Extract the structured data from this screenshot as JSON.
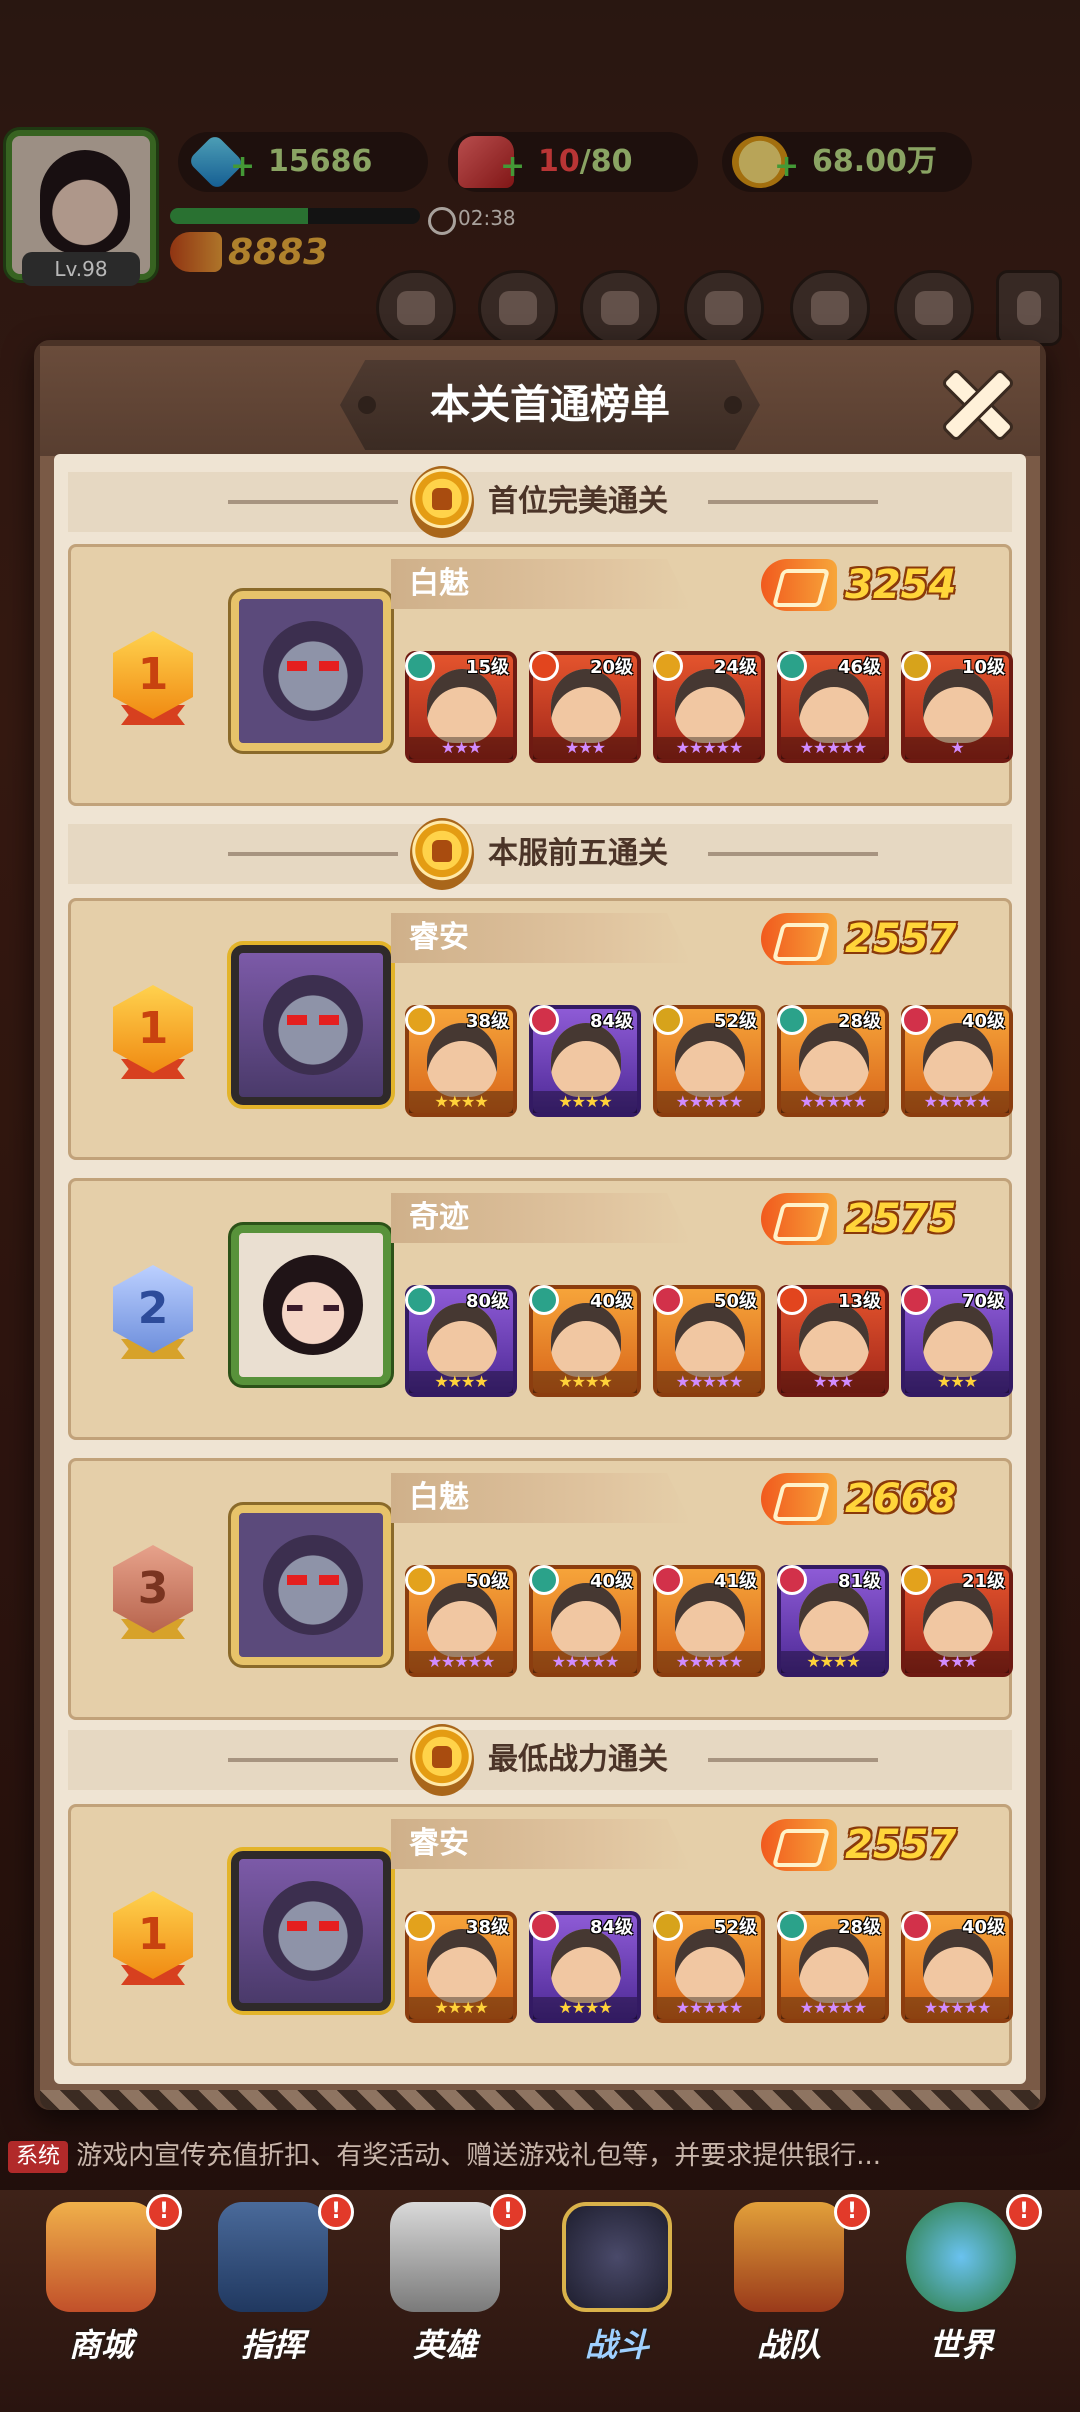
{
  "hud": {
    "level": "Lv.98",
    "gems": "15686",
    "stamina_current": "10",
    "stamina_max": "/80",
    "gold": "68.00万",
    "timer": "02:38",
    "power": "8883",
    "xp_fraction": 0.55
  },
  "modal": {
    "title": "本关首通榜单",
    "sections": {
      "perfect": "首位完美通关",
      "top5": "本服前五通关",
      "lowest": "最低战力通关"
    },
    "entries": [
      {
        "rank": "1",
        "name": "白魅",
        "power": "3254",
        "heroes": [
          {
            "level": "15级",
            "element": "wind",
            "rarity": "red",
            "stars": "★★★"
          },
          {
            "level": "20级",
            "element": "fire",
            "rarity": "red",
            "stars": "★★★"
          },
          {
            "level": "24级",
            "element": "arrow",
            "rarity": "red",
            "stars": "★★★★★"
          },
          {
            "level": "46级",
            "element": "wind",
            "rarity": "red",
            "stars": "★★★★★"
          },
          {
            "level": "10级",
            "element": "gold",
            "rarity": "red",
            "stars": "★"
          }
        ]
      },
      {
        "rank": "1",
        "name": "睿安",
        "power": "2557",
        "heroes": [
          {
            "level": "38级",
            "element": "arrow",
            "rarity": "orange",
            "stars": "★★★★"
          },
          {
            "level": "84级",
            "element": "blood",
            "rarity": "purple",
            "stars": "★★★★"
          },
          {
            "level": "52级",
            "element": "gold",
            "rarity": "orange",
            "stars": "★★★★★"
          },
          {
            "level": "28级",
            "element": "wind",
            "rarity": "orange",
            "stars": "★★★★★"
          },
          {
            "level": "40级",
            "element": "blood",
            "rarity": "orange",
            "stars": "★★★★★"
          }
        ]
      },
      {
        "rank": "2",
        "name": "奇迹",
        "power": "2575",
        "heroes": [
          {
            "level": "80级",
            "element": "wind",
            "rarity": "purple",
            "stars": "★★★★"
          },
          {
            "level": "40级",
            "element": "wind",
            "rarity": "orange",
            "stars": "★★★★"
          },
          {
            "level": "50级",
            "element": "blood",
            "rarity": "orange",
            "stars": "★★★★★"
          },
          {
            "level": "13级",
            "element": "fire",
            "rarity": "red",
            "stars": "★★★"
          },
          {
            "level": "70级",
            "element": "blood",
            "rarity": "purple",
            "stars": "★★★"
          }
        ]
      },
      {
        "rank": "3",
        "name": "白魅",
        "power": "2668",
        "heroes": [
          {
            "level": "50级",
            "element": "arrow",
            "rarity": "orange",
            "stars": "★★★★★"
          },
          {
            "level": "40级",
            "element": "wind",
            "rarity": "orange",
            "stars": "★★★★★"
          },
          {
            "level": "41级",
            "element": "blood",
            "rarity": "orange",
            "stars": "★★★★★"
          },
          {
            "level": "81级",
            "element": "blood",
            "rarity": "purple",
            "stars": "★★★★"
          },
          {
            "level": "21级",
            "element": "arrow",
            "rarity": "red",
            "stars": "★★★"
          }
        ]
      },
      {
        "rank": "1",
        "name": "睿安",
        "power": "2557",
        "heroes": [
          {
            "level": "38级",
            "element": "arrow",
            "rarity": "orange",
            "stars": "★★★★"
          },
          {
            "level": "84级",
            "element": "blood",
            "rarity": "purple",
            "stars": "★★★★"
          },
          {
            "level": "52级",
            "element": "gold",
            "rarity": "orange",
            "stars": "★★★★★"
          },
          {
            "level": "28级",
            "element": "wind",
            "rarity": "orange",
            "stars": "★★★★★"
          },
          {
            "level": "40级",
            "element": "blood",
            "rarity": "orange",
            "stars": "★★★★★"
          }
        ]
      }
    ]
  },
  "chat": {
    "tag": "系统",
    "message": "游戏内宣传充值折扣、有奖活动、赠送游戏礼包等，并要求提供银行..."
  },
  "nav": {
    "items": [
      {
        "label": "商城",
        "badge": "!"
      },
      {
        "label": "指挥",
        "badge": "!"
      },
      {
        "label": "英雄",
        "badge": "!"
      },
      {
        "label": "战斗",
        "badge": ""
      },
      {
        "label": "战队",
        "badge": "!"
      },
      {
        "label": "世界",
        "badge": "!"
      }
    ]
  },
  "colors": {
    "power_text": "#ffd53a",
    "modal_bg": "#efe4d3",
    "card_bg": "#e5cfa9"
  }
}
